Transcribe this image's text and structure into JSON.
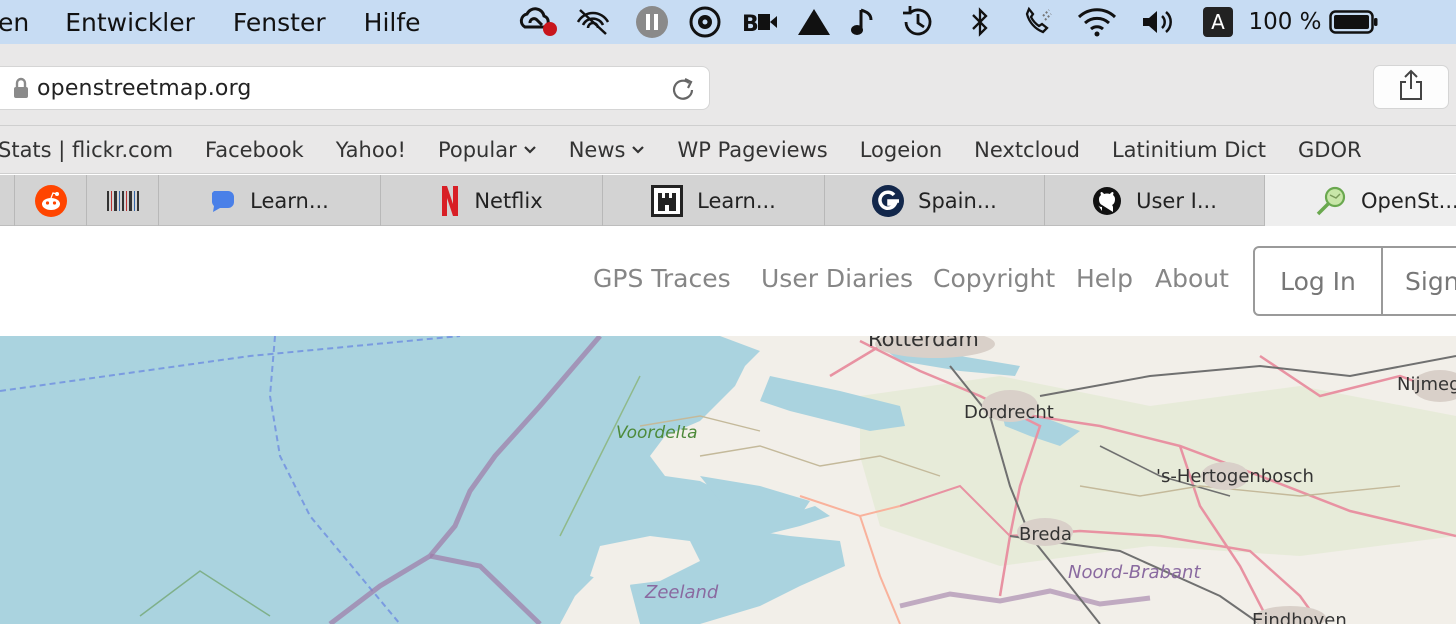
{
  "menubar": {
    "items": [
      "en",
      "Entwickler",
      "Fenster",
      "Hilfe"
    ],
    "battery_text": "100 %",
    "input_source": "A",
    "icons": [
      "creative-cloud-icon",
      "airplay-off-icon",
      "pause-icon",
      "disc-icon",
      "bd-video-icon",
      "triangle-icon",
      "music-note-icon",
      "time-machine-icon",
      "bluetooth-icon",
      "phone-icon",
      "wifi-icon",
      "volume-icon",
      "input-source-icon",
      "battery-icon"
    ]
  },
  "toolbar": {
    "url": "openstreetmap.org"
  },
  "bookmarks": {
    "items": [
      "Stats | flickr.com",
      "Facebook",
      "Yahoo!",
      "Popular",
      "News",
      "WP Pageviews",
      "Logeion",
      "Nextcloud",
      "Latinitium Dict",
      "GDOR"
    ]
  },
  "tabs": [
    {
      "label": "",
      "icon": "reddit-icon"
    },
    {
      "label": "",
      "icon": "barcode-icon"
    },
    {
      "label": "Learn...",
      "icon": "chat-bubble-icon"
    },
    {
      "label": "Netflix",
      "icon": "netflix-icon"
    },
    {
      "label": "Learn...",
      "icon": "castle-icon"
    },
    {
      "label": "Spain...",
      "icon": "g-icon"
    },
    {
      "label": "User I...",
      "icon": "github-icon"
    },
    {
      "label": "OpenSt...",
      "icon": "osm-icon"
    }
  ],
  "osm": {
    "nav": [
      "GPS Traces",
      "User Diaries",
      "Copyright",
      "Help",
      "About"
    ],
    "login": "Log In",
    "signup": "Sign"
  },
  "map": {
    "labels": [
      "Rotterdam",
      "Dordrecht",
      "Voordelta",
      "'s-Hertogenbosch",
      "Nijmeg",
      "Breda",
      "Noord-Brabant",
      "Zeeland",
      "Eindhoven"
    ]
  },
  "colors": {
    "menubar": "#c7dcf3",
    "sea": "#aad3df",
    "land": "#f2efe9",
    "nav_text": "#868686"
  }
}
